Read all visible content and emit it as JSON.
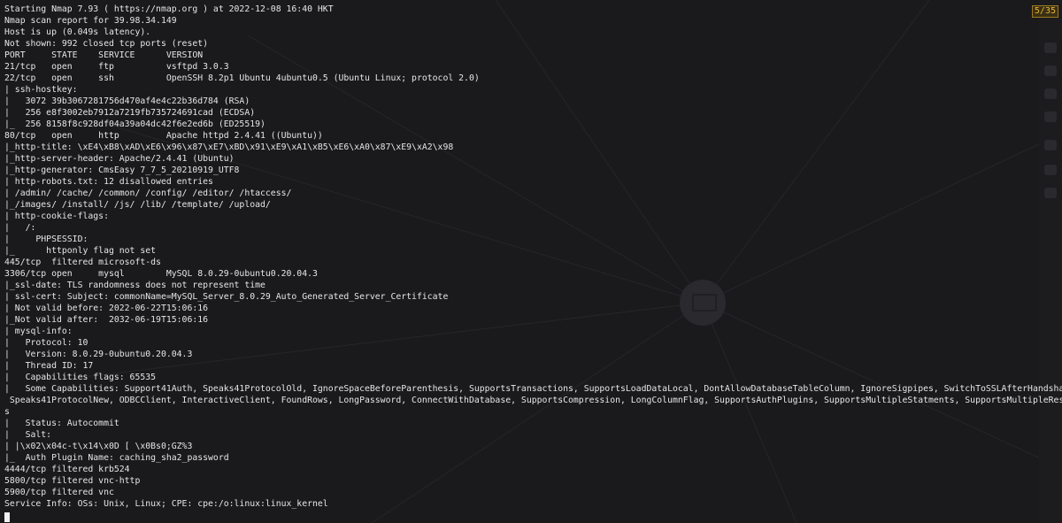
{
  "terminal": {
    "lines": [
      "Starting Nmap 7.93 ( https://nmap.org ) at 2022-12-08 16:40 HKT",
      "Nmap scan report for 39.98.34.149",
      "Host is up (0.049s latency).",
      "Not shown: 992 closed tcp ports (reset)",
      "PORT     STATE    SERVICE      VERSION",
      "21/tcp   open     ftp          vsftpd 3.0.3",
      "22/tcp   open     ssh          OpenSSH 8.2p1 Ubuntu 4ubuntu0.5 (Ubuntu Linux; protocol 2.0)",
      "| ssh-hostkey:",
      "|   3072 39b3067281756d470af4e4c22b36d784 (RSA)",
      "|   256 e8f3002eb7912a7219fb735724691cad (ECDSA)",
      "|_  256 8158f8c928df04a39a04dc42f6e2ed6b (ED25519)",
      "80/tcp   open     http         Apache httpd 2.4.41 ((Ubuntu))",
      "|_http-title: \\xE4\\xB8\\xAD\\xE6\\x96\\x87\\xE7\\xBD\\x91\\xE9\\xA1\\xB5\\xE6\\xA0\\x87\\xE9\\xA2\\x98",
      "|_http-server-header: Apache/2.4.41 (Ubuntu)",
      "|_http-generator: CmsEasy 7_7_5_20210919_UTF8",
      "| http-robots.txt: 12 disallowed entries",
      "| /admin/ /cache/ /common/ /config/ /editor/ /htaccess/",
      "|_/images/ /install/ /js/ /lib/ /template/ /upload/",
      "| http-cookie-flags:",
      "|   /:",
      "|     PHPSESSID:",
      "|_      httponly flag not set",
      "445/tcp  filtered microsoft-ds",
      "3306/tcp open     mysql        MySQL 8.0.29-0ubuntu0.20.04.3",
      "|_ssl-date: TLS randomness does not represent time",
      "| ssl-cert: Subject: commonName=MySQL_Server_8.0.29_Auto_Generated_Server_Certificate",
      "| Not valid before: 2022-06-22T15:06:16",
      "|_Not valid after:  2032-06-19T15:06:16",
      "| mysql-info:",
      "|   Protocol: 10",
      "|   Version: 8.0.29-0ubuntu0.20.04.3",
      "|   Thread ID: 17",
      "|   Capabilities flags: 65535",
      "|   Some Capabilities: Support41Auth, Speaks41ProtocolOld, IgnoreSpaceBeforeParenthesis, SupportsTransactions, SupportsLoadDataLocal, DontAllowDatabaseTableColumn, IgnoreSigpipes, SwitchToSSLAfterHandshake,",
      " Speaks41ProtocolNew, ODBCClient, InteractiveClient, FoundRows, LongPassword, ConnectWithDatabase, SupportsCompression, LongColumnFlag, SupportsAuthPlugins, SupportsMultipleStatments, SupportsMultipleResult",
      "s",
      "|   Status: Autocommit",
      "|   Salt:",
      "| |\\x02\\x04c-t\\x14\\x0D [ \\x0Bs0;GZ%3",
      "|_  Auth Plugin Name: caching_sha2_password",
      "4444/tcp filtered krb524",
      "5800/tcp filtered vnc-http",
      "5900/tcp filtered vnc",
      "Service Info: OSs: Unix, Linux; CPE: cpe:/o:linux:linux_kernel"
    ]
  },
  "counter": {
    "label": "5/35"
  },
  "colors": {
    "background": "#1a1a1d",
    "text": "#e6e6e6",
    "counter_fg": "#e4b53a",
    "counter_bg": "#3a2f12"
  }
}
